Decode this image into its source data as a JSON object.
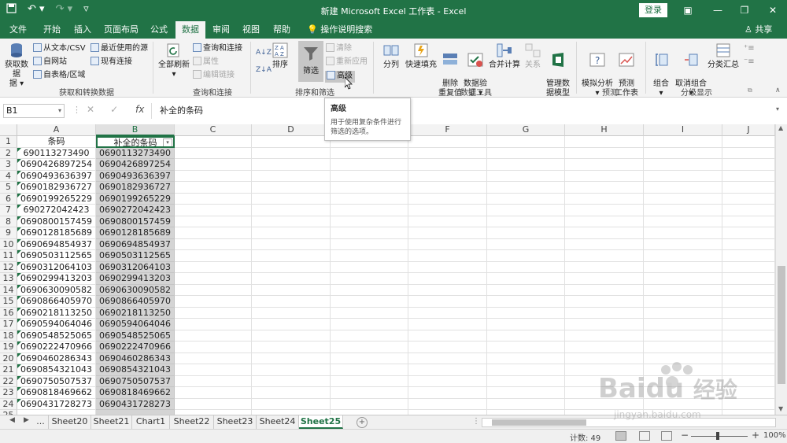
{
  "colors": {
    "brand": "#217346",
    "selected_col": "#d4d4d4"
  },
  "titlebar": {
    "title": "新建 Microsoft Excel 工作表 - Excel",
    "login": "登录",
    "qa_icons": [
      "save-icon",
      "undo-icon",
      "redo-icon",
      "customize-icon"
    ]
  },
  "tabs": [
    "文件",
    "开始",
    "插入",
    "页面布局",
    "公式",
    "数据",
    "审阅",
    "视图",
    "帮助"
  ],
  "tell_me": "操作说明搜索",
  "share": "共享",
  "ribbon": {
    "get_data": "获取数据",
    "from_text": "从文本/CSV",
    "from_web": "自网站",
    "from_table": "自表格/区域",
    "recent_sources": "最近使用的源",
    "existing_conn": "现有连接",
    "group_get": "获取和转换数据",
    "refresh_all": "全部刷新",
    "queries_conn": "查询和连接",
    "properties": "属性",
    "edit_links": "编辑链接",
    "group_queries": "查询和连接",
    "sort_az": "A↓Z",
    "sort_za": "Z↓A",
    "sort": "排序",
    "filter": "筛选",
    "clear": "清除",
    "reapply": "重新应用",
    "advanced": "高级",
    "group_sort": "排序和筛选",
    "text_to_cols": "分列",
    "flash_fill": "快速填充",
    "remove_dup": "删除\n重复值",
    "validation": "数据验\n证 ▾",
    "consolidate": "合并计算",
    "relationships": "关系",
    "data_model": "管理数\n据模型",
    "group_tools": "数据工具",
    "whatif": "模拟分析\n▾",
    "forecast_sheet": "预测\n工作表",
    "group_forecast": "预测",
    "group": "组合\n▾",
    "ungroup": "取消组合\n▾",
    "subtotal": "分类汇总",
    "group_outline": "分级显示"
  },
  "tooltip": {
    "title": "高级",
    "desc": "用于使用复杂条件进行筛选的选项。"
  },
  "formula_bar": {
    "name_box": "B1",
    "formula": "补全的条码"
  },
  "columns": [
    "A",
    "B",
    "C",
    "D",
    "E",
    "F",
    "G",
    "H",
    "I",
    "J"
  ],
  "header_a": "条码",
  "header_b": "补全的条码",
  "rows": [
    [
      "690113273490",
      "0690113273490"
    ],
    [
      "0690426897254",
      "0690426897254"
    ],
    [
      "0690493636397",
      "0690493636397"
    ],
    [
      "0690182936727",
      "0690182936727"
    ],
    [
      "0690199265229",
      "0690199265229"
    ],
    [
      "690272042423",
      "0690272042423"
    ],
    [
      "0690800157459",
      "0690800157459"
    ],
    [
      "0690128185689",
      "0690128185689"
    ],
    [
      "0690694854937",
      "0690694854937"
    ],
    [
      "0690503112565",
      "0690503112565"
    ],
    [
      "0690312064103",
      "0690312064103"
    ],
    [
      "0690299413203",
      "0690299413203"
    ],
    [
      "0690630090582",
      "0690630090582"
    ],
    [
      "0690866405970",
      "0690866405970"
    ],
    [
      "0690218113250",
      "0690218113250"
    ],
    [
      "0690594064046",
      "0690594064046"
    ],
    [
      "0690548525065",
      "0690548525065"
    ],
    [
      "0690222470966",
      "0690222470966"
    ],
    [
      "0690460286343",
      "0690460286343"
    ],
    [
      "0690854321043",
      "0690854321043"
    ],
    [
      "0690750507537",
      "0690750507537"
    ],
    [
      "0690818469662",
      "0690818469662"
    ],
    [
      "0690431728273",
      "0690431728273"
    ]
  ],
  "sheets": [
    "...",
    "Sheet20",
    "Sheet21",
    "Chart1",
    "Sheet22",
    "Sheet23",
    "Sheet24",
    "Sheet25"
  ],
  "status": {
    "count": "计数: 49",
    "zoom": "100%"
  },
  "watermark": {
    "brand": "Bai",
    "brand2": "du",
    "cn": "经验",
    "url": "jingyan.baidu.com"
  }
}
